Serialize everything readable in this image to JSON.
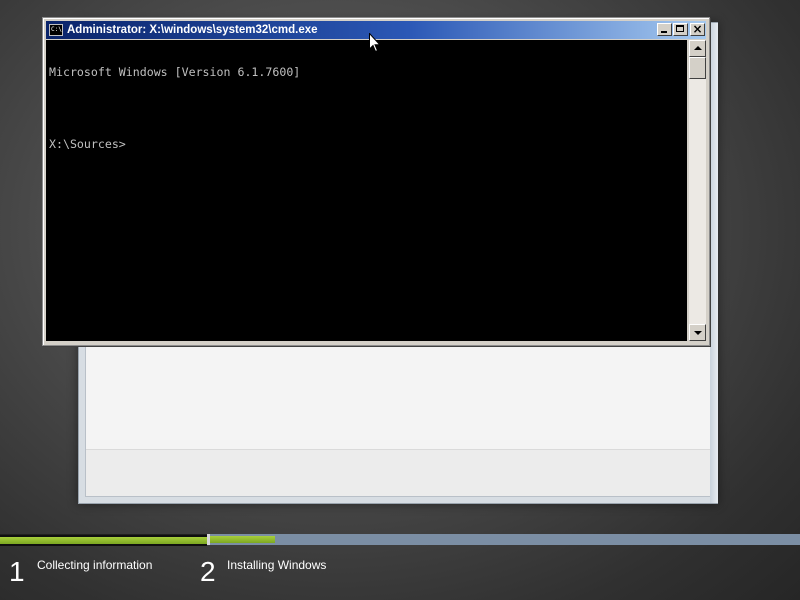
{
  "setup_window": {},
  "cmd_window": {
    "title": "Administrator: X:\\windows\\system32\\cmd.exe",
    "icon": "console-icon",
    "icon_text": "C:\\",
    "console_lines": [
      "Microsoft Windows [Version 6.1.7600]",
      "",
      "X:\\Sources>"
    ],
    "controls": [
      "minimize-icon",
      "maximize-icon",
      "close-icon"
    ],
    "close_glyph": "×"
  },
  "progress": {
    "step1_fill": 1.0,
    "step2_fill": 0.11,
    "colors": {
      "fill": "#8cbc2d",
      "pending": "#7b8ea4"
    },
    "steps": [
      {
        "number": "1",
        "label": "Collecting information"
      },
      {
        "number": "2",
        "label": "Installing Windows"
      }
    ]
  }
}
